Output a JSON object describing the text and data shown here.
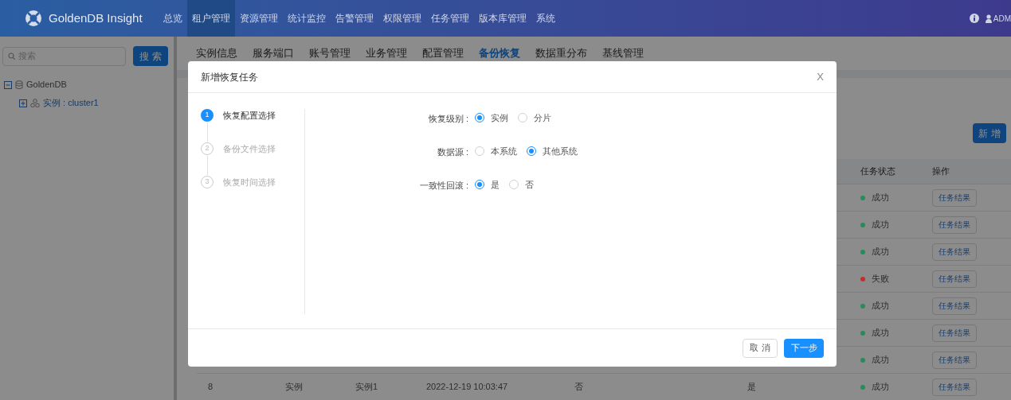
{
  "header": {
    "logo_text": "GoldenDB Insight",
    "user": "ADM",
    "nav": [
      {
        "label": "总览",
        "selected": false
      },
      {
        "label": "租户管理",
        "selected": true
      },
      {
        "label": "资源管理",
        "selected": false
      },
      {
        "label": "统计监控",
        "selected": false
      },
      {
        "label": "告警管理",
        "selected": false
      },
      {
        "label": "权限管理",
        "selected": false
      },
      {
        "label": "任务管理",
        "selected": false
      },
      {
        "label": "版本库管理",
        "selected": false
      },
      {
        "label": "系统",
        "selected": false
      }
    ]
  },
  "sidebar": {
    "search": {
      "placeholder": "搜索"
    },
    "search_button": "搜 索",
    "tree": [
      {
        "label": "GoldenDB",
        "kind": "database",
        "expanded": true,
        "children": [
          {
            "label": "实例 : cluster1",
            "kind": "cluster",
            "expanded": false
          }
        ]
      }
    ]
  },
  "subtabs": [
    {
      "label": "实例信息",
      "selected": false
    },
    {
      "label": "服务端口",
      "selected": false
    },
    {
      "label": "账号管理",
      "selected": false
    },
    {
      "label": "业务管理",
      "selected": false
    },
    {
      "label": "配置管理",
      "selected": false
    },
    {
      "label": "备份恢复",
      "selected": true
    },
    {
      "label": "数据重分布",
      "selected": false
    },
    {
      "label": "基线管理",
      "selected": false
    }
  ],
  "add_button": "新 增",
  "table": {
    "columns": {
      "status": "任务状态",
      "action": "操作"
    },
    "rows": [
      {
        "status": "成功",
        "color": "#2a8a5c",
        "action": "任务结果"
      },
      {
        "status": "成功",
        "color": "#2a8a5c",
        "action": "任务结果"
      },
      {
        "status": "成功",
        "color": "#2a8a5c",
        "action": "任务结果"
      },
      {
        "status": "失败",
        "color": "#c03030",
        "action": "任务结果"
      },
      {
        "status": "成功",
        "color": "#2a8a5c",
        "action": "任务结果"
      },
      {
        "status": "成功",
        "color": "#2a8a5c",
        "action": "任务结果"
      },
      {
        "status": "成功",
        "color": "#2a8a5c",
        "action": "任务结果"
      },
      {
        "column_1": "8",
        "column_2": "实例",
        "column_3": "实例1",
        "column_4": "2022-12-19 10:03:47",
        "column_5": "否",
        "column_6": "是",
        "status": "成功",
        "color": "#2a8a5c",
        "action": "任务结果"
      }
    ]
  },
  "dialog": {
    "title": "新增恢复任务",
    "close": "X",
    "steps": [
      {
        "number": "1",
        "label": "恢复配置选择",
        "selected": true
      },
      {
        "number": "2",
        "label": "备份文件选择",
        "selected": false
      },
      {
        "number": "3",
        "label": "恢复时间选择",
        "selected": false
      }
    ],
    "fields": [
      {
        "label": "恢复级别 :",
        "options": [
          {
            "label": "实例",
            "selected": true
          },
          {
            "label": "分片",
            "selected": false
          }
        ]
      },
      {
        "label": "数据源 :",
        "options": [
          {
            "label": "本系统",
            "selected": false
          },
          {
            "label": "其他系统",
            "selected": true
          }
        ]
      },
      {
        "label": "一致性回滚 :",
        "options": [
          {
            "label": "是",
            "selected": true
          },
          {
            "label": "否",
            "selected": false
          }
        ]
      }
    ],
    "cancel_button": "取 消",
    "next_button": "下一步"
  }
}
